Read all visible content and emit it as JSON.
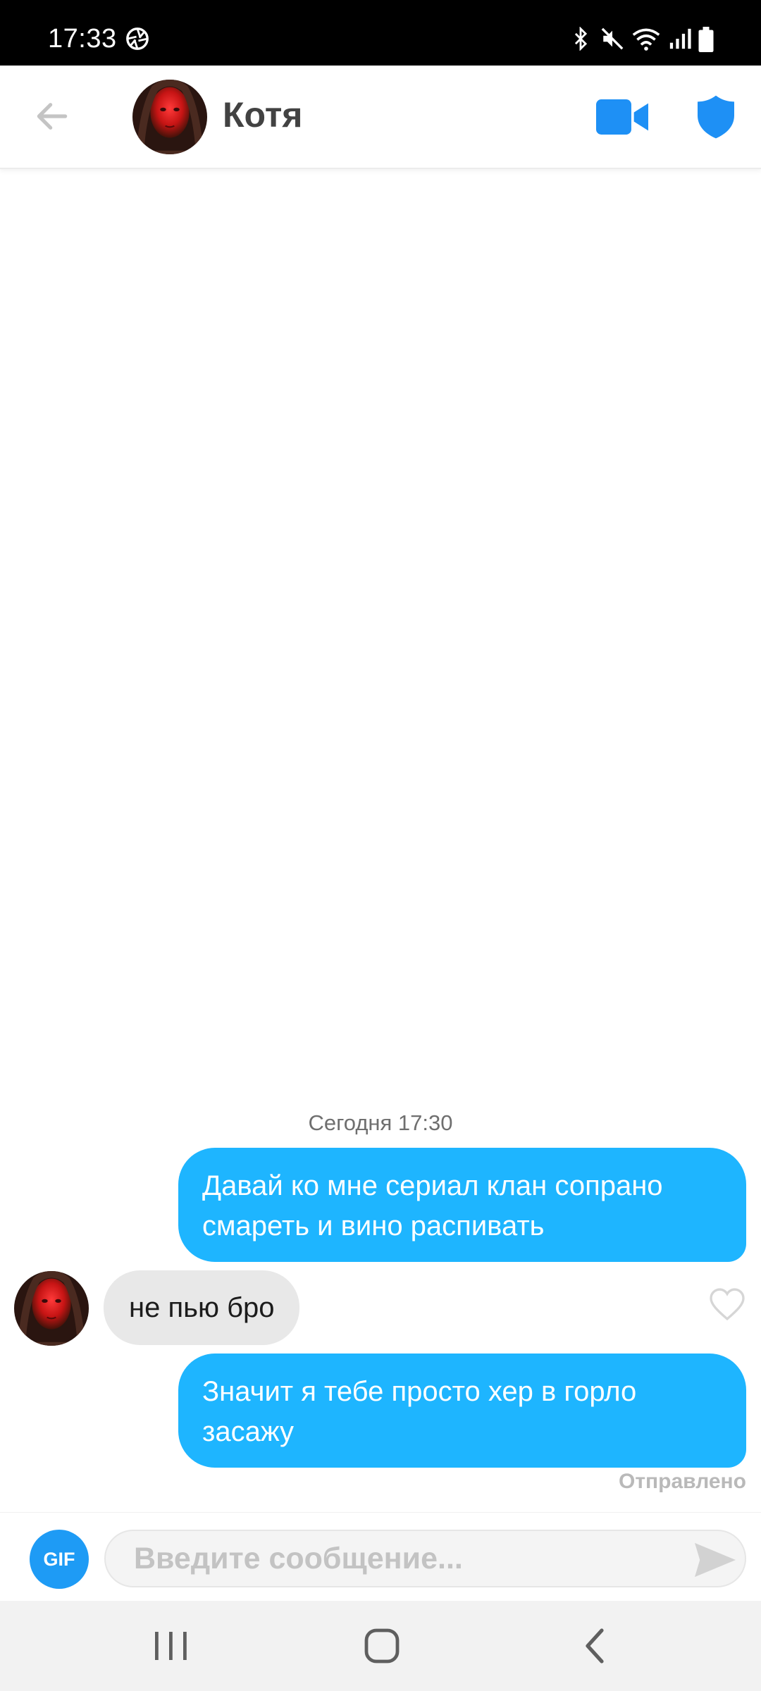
{
  "status_bar": {
    "time": "17:33",
    "left_icons": [
      "aperture-icon"
    ],
    "right_icons": [
      "bluetooth-icon",
      "mute-icon",
      "wifi-icon",
      "signal-icon",
      "battery-icon"
    ]
  },
  "header": {
    "contact_name": "Котя",
    "icons": [
      "back-arrow-icon",
      "video-camera-icon",
      "shield-icon"
    ]
  },
  "chat": {
    "timestamp": "Сегодня 17:30",
    "messages": [
      {
        "direction": "outgoing",
        "text": "Давай ко мне сериал клан сопрано смареть и вино распивать"
      },
      {
        "direction": "incoming",
        "text": "не пью бро"
      },
      {
        "direction": "outgoing",
        "text": "Значит я тебе просто хер в горло засажу"
      }
    ],
    "last_status": "Отправлено"
  },
  "composer": {
    "gif_label": "GIF",
    "placeholder": "Введите сообщение...",
    "value": ""
  },
  "nav_bar": {
    "icons": [
      "recent-apps-icon",
      "home-icon",
      "back-icon"
    ]
  },
  "colors": {
    "outgoing_bubble": "#1eb5ff",
    "incoming_bubble": "#e8e8e8",
    "accent_blue": "#1e90f5",
    "gif_button": "#1e9bf5"
  }
}
